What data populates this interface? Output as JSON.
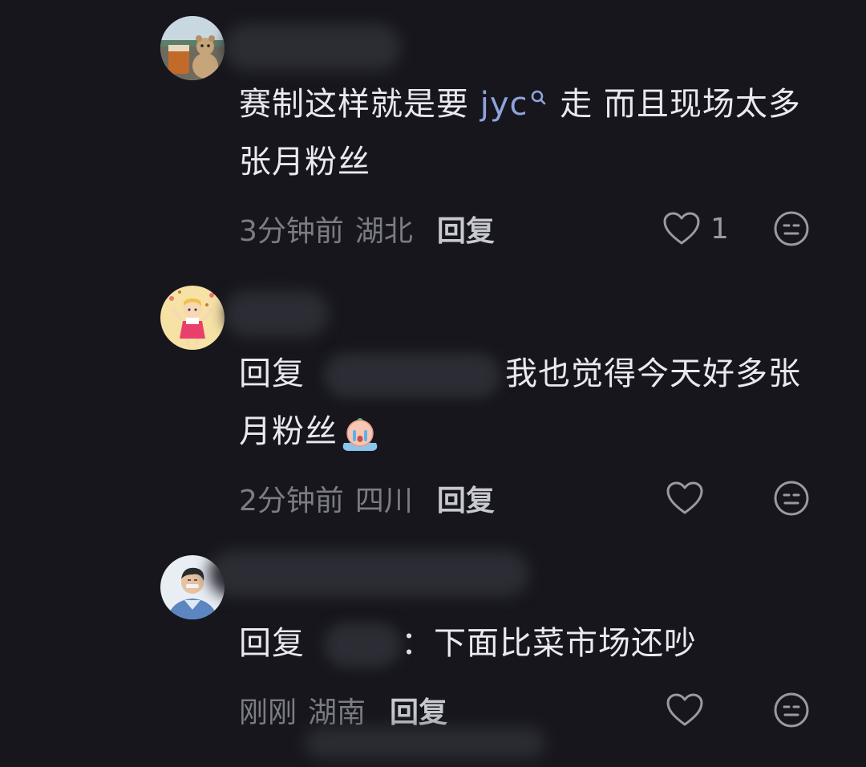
{
  "comments": [
    {
      "avatar_icon": "avatar-iced-coffee-bear",
      "text_before_link": "赛制这样就是要 ",
      "link_text": "jyc",
      "text_after_link": " 走 而且现场太多张月粉丝",
      "time": "3分钟前",
      "location": "湖北",
      "reply_label": "回复",
      "like_count": "1"
    },
    {
      "avatar_icon": "avatar-girl-cartoon",
      "reply_prefix": "回复",
      "text": "我也觉得今天好多张月粉丝",
      "emoji_icon": "crying-face-emoji",
      "time": "2分钟前",
      "location": "四川",
      "reply_label": "回复",
      "like_count": ""
    },
    {
      "avatar_icon": "avatar-man-cartoon",
      "reply_prefix": "回复",
      "text": "：下面比菜市场还吵",
      "time": "刚刚",
      "location": "湖南",
      "reply_label": "回复",
      "like_count": ""
    }
  ],
  "colors": {
    "background": "#16161c",
    "text": "#e9e9ef",
    "meta": "#7c7c86",
    "link": "#8fa4dd"
  }
}
